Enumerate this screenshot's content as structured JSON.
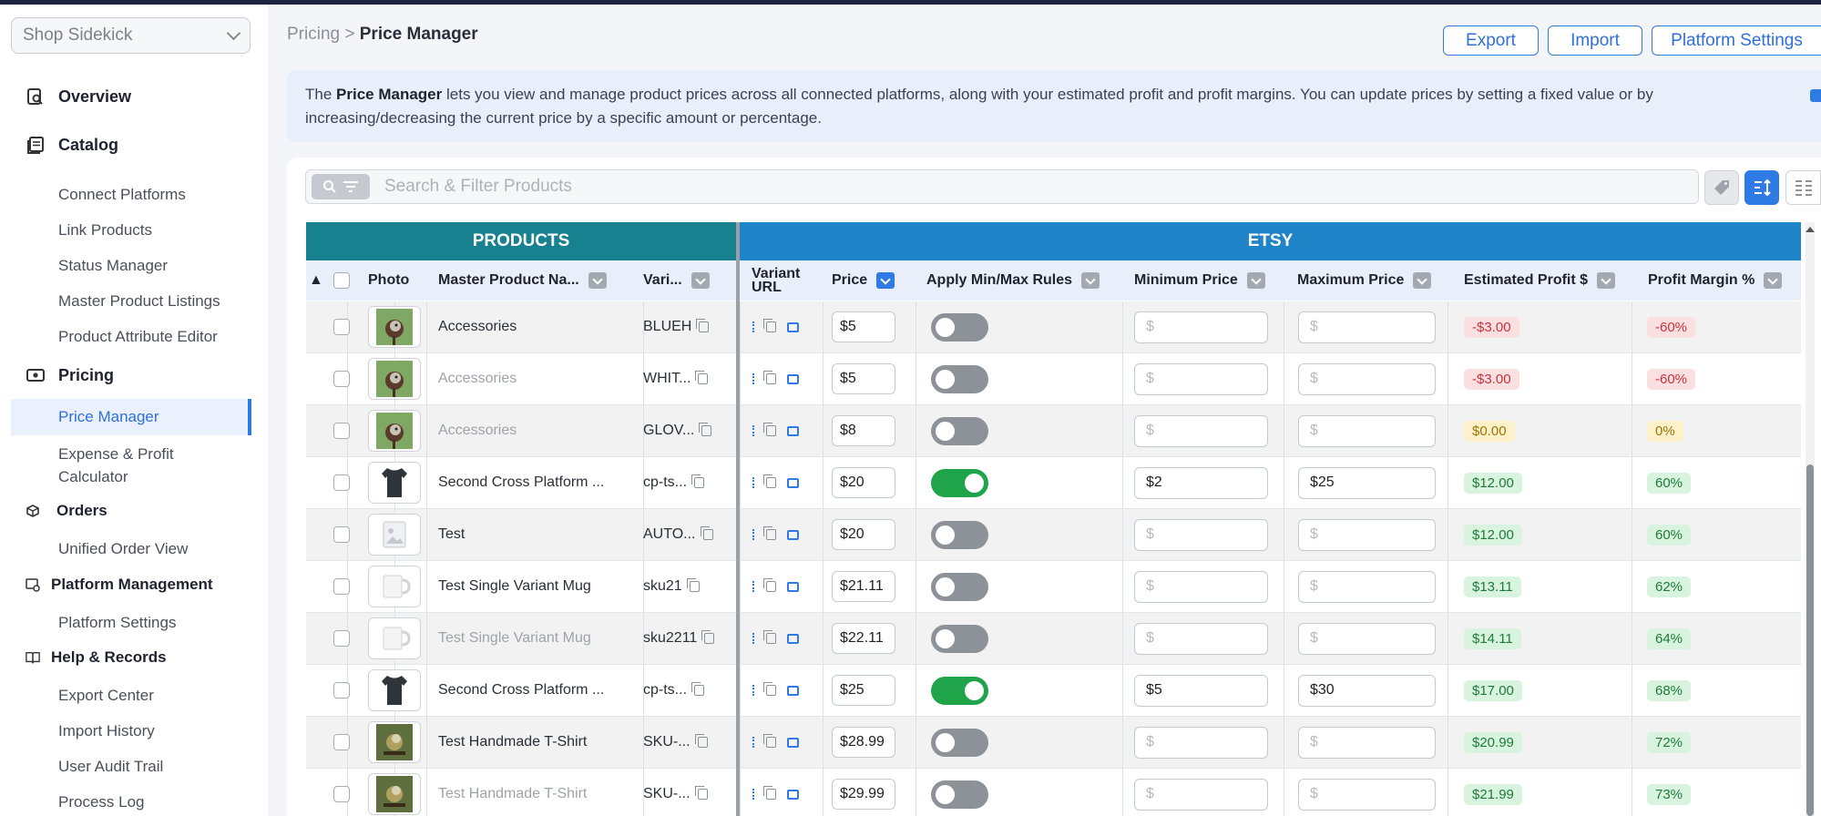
{
  "sidebar": {
    "store_select": "Shop Sidekick",
    "sections": {
      "overview": "Overview",
      "catalog": "Catalog",
      "pricing": "Pricing",
      "orders": "Orders",
      "platform_management": "Platform Management",
      "help_records": "Help & Records"
    },
    "catalog_items": [
      "Connect Platforms",
      "Link Products",
      "Status Manager",
      "Master Product Listings",
      "Product Attribute Editor"
    ],
    "pricing_items": [
      "Price Manager",
      "Expense & Profit",
      "Calculator"
    ],
    "orders_items": [
      "Unified Order View"
    ],
    "platform_items": [
      "Platform Settings"
    ],
    "help_items": [
      "Export Center",
      "Import History",
      "User Audit Trail",
      "Process Log"
    ]
  },
  "header": {
    "breadcrumb_parent": "Pricing",
    "breadcrumb_sep": ">",
    "breadcrumb_current": "Price Manager",
    "export_label": "Export",
    "import_label": "Import",
    "platform_settings_label": "Platform Settings"
  },
  "info": {
    "bold": "Price Manager",
    "prefix": "The ",
    "text": " lets you view and manage product prices across all connected platforms, along with your estimated profit and profit margins. You can update prices by setting a fixed value or by",
    "text2": "increasing/decreasing the current price by a specific amount or percentage."
  },
  "search": {
    "placeholder": "Search & Filter Products"
  },
  "table": {
    "group_products": "PRODUCTS",
    "group_etsy": "ETSY",
    "sort_indicator": "▲",
    "columns": {
      "photo": "Photo",
      "master_product_name": "Master Product Na...",
      "variant": "Vari...",
      "variant_url_line1": "Variant",
      "variant_url_line2": "URL",
      "price": "Price",
      "apply_minmax": "Apply Min/Max Rules",
      "minimum_price": "Minimum Price",
      "maximum_price": "Maximum Price",
      "estimated_profit": "Estimated Profit $",
      "profit_margin": "Profit Margin %"
    },
    "currency_placeholder": "$",
    "rows": [
      {
        "name": "Accessories",
        "variant": "BLUEH",
        "price": "$5",
        "minmax": false,
        "min": "",
        "max": "",
        "profit": "-$3.00",
        "margin": "-60%",
        "tone": "red",
        "muted": false,
        "photo": "bird"
      },
      {
        "name": "Accessories",
        "variant": "WHIT...",
        "price": "$5",
        "minmax": false,
        "min": "",
        "max": "",
        "profit": "-$3.00",
        "margin": "-60%",
        "tone": "red",
        "muted": true,
        "photo": "bird"
      },
      {
        "name": "Accessories",
        "variant": "GLOV...",
        "price": "$8",
        "minmax": false,
        "min": "",
        "max": "",
        "profit": "$0.00",
        "margin": "0%",
        "tone": "yellow",
        "muted": true,
        "photo": "bird"
      },
      {
        "name": "Second Cross Platform ...",
        "variant": "cp-ts...",
        "price": "$20",
        "minmax": true,
        "min": "$2",
        "max": "$25",
        "profit": "$12.00",
        "margin": "60%",
        "tone": "green",
        "muted": false,
        "photo": "shirt"
      },
      {
        "name": "Test",
        "variant": "AUTO...",
        "price": "$20",
        "minmax": false,
        "min": "",
        "max": "",
        "profit": "$12.00",
        "margin": "60%",
        "tone": "green",
        "muted": false,
        "photo": "placeholder"
      },
      {
        "name": "Test Single Variant Mug",
        "variant": "sku21",
        "price": "$21.11",
        "minmax": false,
        "min": "",
        "max": "",
        "profit": "$13.11",
        "margin": "62%",
        "tone": "green",
        "muted": false,
        "photo": "mug"
      },
      {
        "name": "Test Single Variant Mug",
        "variant": "sku2211",
        "price": "$22.11",
        "minmax": false,
        "min": "",
        "max": "",
        "profit": "$14.11",
        "margin": "64%",
        "tone": "green",
        "muted": true,
        "photo": "mug"
      },
      {
        "name": "Second Cross Platform ...",
        "variant": "cp-ts...",
        "price": "$25",
        "minmax": true,
        "min": "$5",
        "max": "$30",
        "profit": "$17.00",
        "margin": "68%",
        "tone": "green",
        "muted": false,
        "photo": "shirt"
      },
      {
        "name": "Test Handmade T-Shirt",
        "variant": "SKU-...",
        "price": "$28.99",
        "minmax": false,
        "min": "",
        "max": "",
        "profit": "$20.99",
        "margin": "72%",
        "tone": "green",
        "muted": false,
        "photo": "bird2"
      },
      {
        "name": "Test Handmade T-Shirt",
        "variant": "SKU-...",
        "price": "$29.99",
        "minmax": false,
        "min": "",
        "max": "",
        "profit": "$21.99",
        "margin": "73%",
        "tone": "green",
        "muted": true,
        "photo": "bird2"
      }
    ]
  },
  "colors": {
    "accent": "#2e7be6",
    "products_header": "#17818f",
    "etsy_header": "#1f84c8",
    "toggle_on": "#1fa44a"
  }
}
